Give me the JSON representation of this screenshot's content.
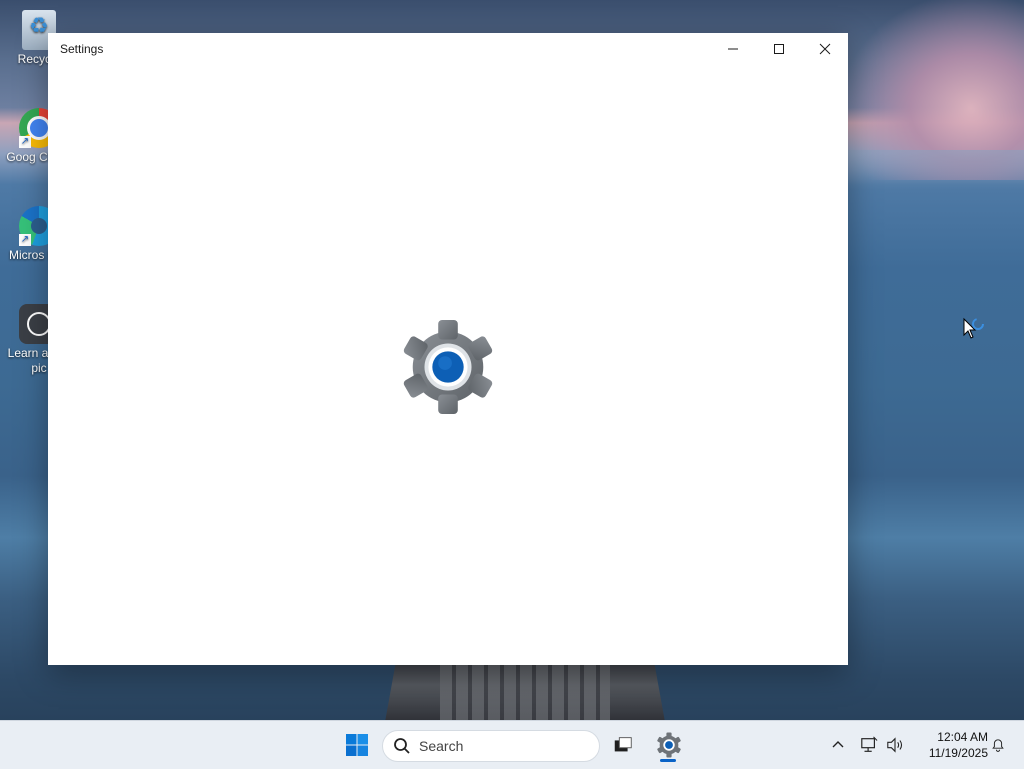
{
  "window": {
    "title": "Settings",
    "controls": [
      "minimize",
      "maximize",
      "close"
    ]
  },
  "desktop_icons": [
    {
      "label": "Recycle",
      "icon": "recycle-bin-icon"
    },
    {
      "label": "Goog Chron",
      "icon": "chrome-icon"
    },
    {
      "label": "Micros Edg",
      "icon": "edge-icon"
    },
    {
      "label": "Learn a this pic",
      "icon": "learn-about-picture-icon"
    }
  ],
  "taskbar": {
    "search_placeholder": "Search",
    "time": "12:04 AM",
    "date": "11/19/2025"
  },
  "colors": {
    "accent": "#0a63c7",
    "gear_gray": "#6e7378",
    "gear_center": "#0d5fb5"
  }
}
